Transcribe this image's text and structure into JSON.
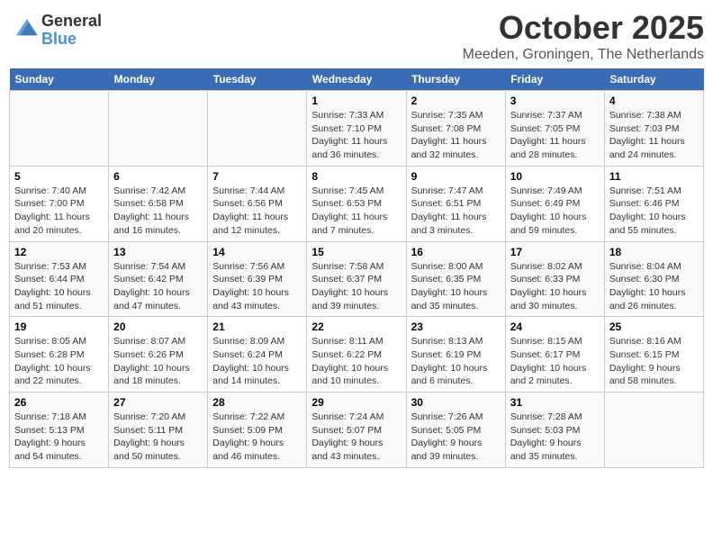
{
  "header": {
    "logo_line1": "General",
    "logo_line2": "Blue",
    "month": "October 2025",
    "location": "Meeden, Groningen, The Netherlands"
  },
  "weekdays": [
    "Sunday",
    "Monday",
    "Tuesday",
    "Wednesday",
    "Thursday",
    "Friday",
    "Saturday"
  ],
  "weeks": [
    [
      {
        "day": "",
        "info": ""
      },
      {
        "day": "",
        "info": ""
      },
      {
        "day": "",
        "info": ""
      },
      {
        "day": "1",
        "info": "Sunrise: 7:33 AM\nSunset: 7:10 PM\nDaylight: 11 hours\nand 36 minutes."
      },
      {
        "day": "2",
        "info": "Sunrise: 7:35 AM\nSunset: 7:08 PM\nDaylight: 11 hours\nand 32 minutes."
      },
      {
        "day": "3",
        "info": "Sunrise: 7:37 AM\nSunset: 7:05 PM\nDaylight: 11 hours\nand 28 minutes."
      },
      {
        "day": "4",
        "info": "Sunrise: 7:38 AM\nSunset: 7:03 PM\nDaylight: 11 hours\nand 24 minutes."
      }
    ],
    [
      {
        "day": "5",
        "info": "Sunrise: 7:40 AM\nSunset: 7:00 PM\nDaylight: 11 hours\nand 20 minutes."
      },
      {
        "day": "6",
        "info": "Sunrise: 7:42 AM\nSunset: 6:58 PM\nDaylight: 11 hours\nand 16 minutes."
      },
      {
        "day": "7",
        "info": "Sunrise: 7:44 AM\nSunset: 6:56 PM\nDaylight: 11 hours\nand 12 minutes."
      },
      {
        "day": "8",
        "info": "Sunrise: 7:45 AM\nSunset: 6:53 PM\nDaylight: 11 hours\nand 7 minutes."
      },
      {
        "day": "9",
        "info": "Sunrise: 7:47 AM\nSunset: 6:51 PM\nDaylight: 11 hours\nand 3 minutes."
      },
      {
        "day": "10",
        "info": "Sunrise: 7:49 AM\nSunset: 6:49 PM\nDaylight: 10 hours\nand 59 minutes."
      },
      {
        "day": "11",
        "info": "Sunrise: 7:51 AM\nSunset: 6:46 PM\nDaylight: 10 hours\nand 55 minutes."
      }
    ],
    [
      {
        "day": "12",
        "info": "Sunrise: 7:53 AM\nSunset: 6:44 PM\nDaylight: 10 hours\nand 51 minutes."
      },
      {
        "day": "13",
        "info": "Sunrise: 7:54 AM\nSunset: 6:42 PM\nDaylight: 10 hours\nand 47 minutes."
      },
      {
        "day": "14",
        "info": "Sunrise: 7:56 AM\nSunset: 6:39 PM\nDaylight: 10 hours\nand 43 minutes."
      },
      {
        "day": "15",
        "info": "Sunrise: 7:58 AM\nSunset: 6:37 PM\nDaylight: 10 hours\nand 39 minutes."
      },
      {
        "day": "16",
        "info": "Sunrise: 8:00 AM\nSunset: 6:35 PM\nDaylight: 10 hours\nand 35 minutes."
      },
      {
        "day": "17",
        "info": "Sunrise: 8:02 AM\nSunset: 6:33 PM\nDaylight: 10 hours\nand 30 minutes."
      },
      {
        "day": "18",
        "info": "Sunrise: 8:04 AM\nSunset: 6:30 PM\nDaylight: 10 hours\nand 26 minutes."
      }
    ],
    [
      {
        "day": "19",
        "info": "Sunrise: 8:05 AM\nSunset: 6:28 PM\nDaylight: 10 hours\nand 22 minutes."
      },
      {
        "day": "20",
        "info": "Sunrise: 8:07 AM\nSunset: 6:26 PM\nDaylight: 10 hours\nand 18 minutes."
      },
      {
        "day": "21",
        "info": "Sunrise: 8:09 AM\nSunset: 6:24 PM\nDaylight: 10 hours\nand 14 minutes."
      },
      {
        "day": "22",
        "info": "Sunrise: 8:11 AM\nSunset: 6:22 PM\nDaylight: 10 hours\nand 10 minutes."
      },
      {
        "day": "23",
        "info": "Sunrise: 8:13 AM\nSunset: 6:19 PM\nDaylight: 10 hours\nand 6 minutes."
      },
      {
        "day": "24",
        "info": "Sunrise: 8:15 AM\nSunset: 6:17 PM\nDaylight: 10 hours\nand 2 minutes."
      },
      {
        "day": "25",
        "info": "Sunrise: 8:16 AM\nSunset: 6:15 PM\nDaylight: 9 hours\nand 58 minutes."
      }
    ],
    [
      {
        "day": "26",
        "info": "Sunrise: 7:18 AM\nSunset: 5:13 PM\nDaylight: 9 hours\nand 54 minutes."
      },
      {
        "day": "27",
        "info": "Sunrise: 7:20 AM\nSunset: 5:11 PM\nDaylight: 9 hours\nand 50 minutes."
      },
      {
        "day": "28",
        "info": "Sunrise: 7:22 AM\nSunset: 5:09 PM\nDaylight: 9 hours\nand 46 minutes."
      },
      {
        "day": "29",
        "info": "Sunrise: 7:24 AM\nSunset: 5:07 PM\nDaylight: 9 hours\nand 43 minutes."
      },
      {
        "day": "30",
        "info": "Sunrise: 7:26 AM\nSunset: 5:05 PM\nDaylight: 9 hours\nand 39 minutes."
      },
      {
        "day": "31",
        "info": "Sunrise: 7:28 AM\nSunset: 5:03 PM\nDaylight: 9 hours\nand 35 minutes."
      },
      {
        "day": "",
        "info": ""
      }
    ]
  ]
}
